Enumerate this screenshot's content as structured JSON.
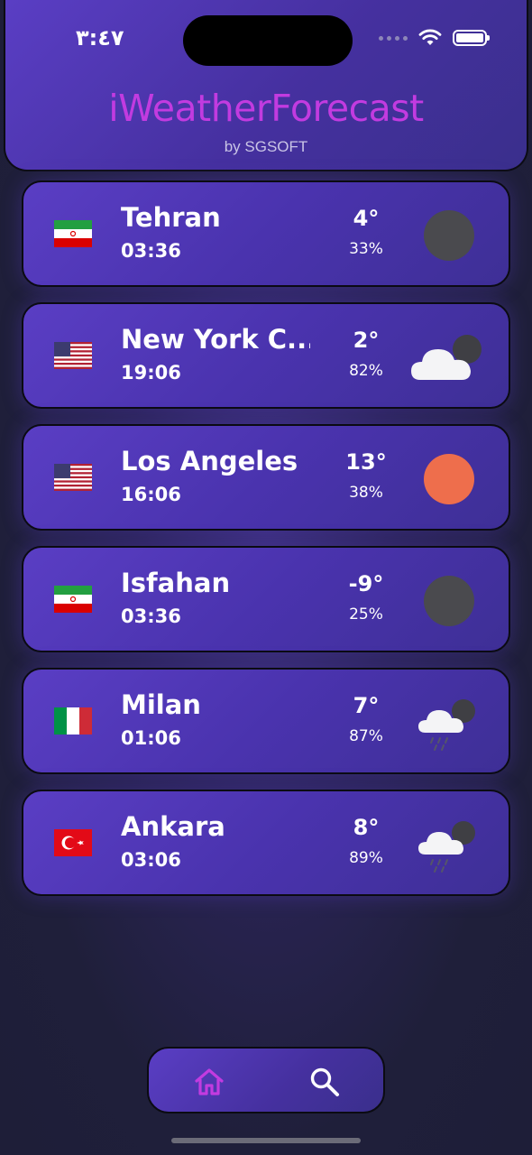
{
  "status_bar": {
    "time": "٣:٤٧"
  },
  "header": {
    "title": "iWeatherForecast",
    "subtitle": "by SGSOFT"
  },
  "colors": {
    "accent": "#c23be0",
    "card": "#4a33ae",
    "sun": "#ee6e4c",
    "moon": "#4a4a4e"
  },
  "cities": [
    {
      "name": "Tehran",
      "time": "03:36",
      "temp": "4°",
      "humidity": "33%",
      "flag": "iran-flag",
      "icon": "moon-icon"
    },
    {
      "name": "New York C...",
      "time": "19:06",
      "temp": "2°",
      "humidity": "82%",
      "flag": "usa-flag",
      "icon": "cloudy-night-icon"
    },
    {
      "name": "Los Angeles",
      "time": "16:06",
      "temp": "13°",
      "humidity": "38%",
      "flag": "usa-flag",
      "icon": "sun-icon"
    },
    {
      "name": "Isfahan",
      "time": "03:36",
      "temp": "-9°",
      "humidity": "25%",
      "flag": "iran-flag",
      "icon": "moon-icon"
    },
    {
      "name": "Milan",
      "time": "01:06",
      "temp": "7°",
      "humidity": "87%",
      "flag": "italy-flag",
      "icon": "rain-night-icon"
    },
    {
      "name": "Ankara",
      "time": "03:06",
      "temp": "8°",
      "humidity": "89%",
      "flag": "turkey-flag",
      "icon": "rain-night-icon"
    }
  ],
  "tabbar": {
    "items": [
      {
        "icon": "home-icon",
        "active": true
      },
      {
        "icon": "search-icon",
        "active": false
      }
    ]
  }
}
